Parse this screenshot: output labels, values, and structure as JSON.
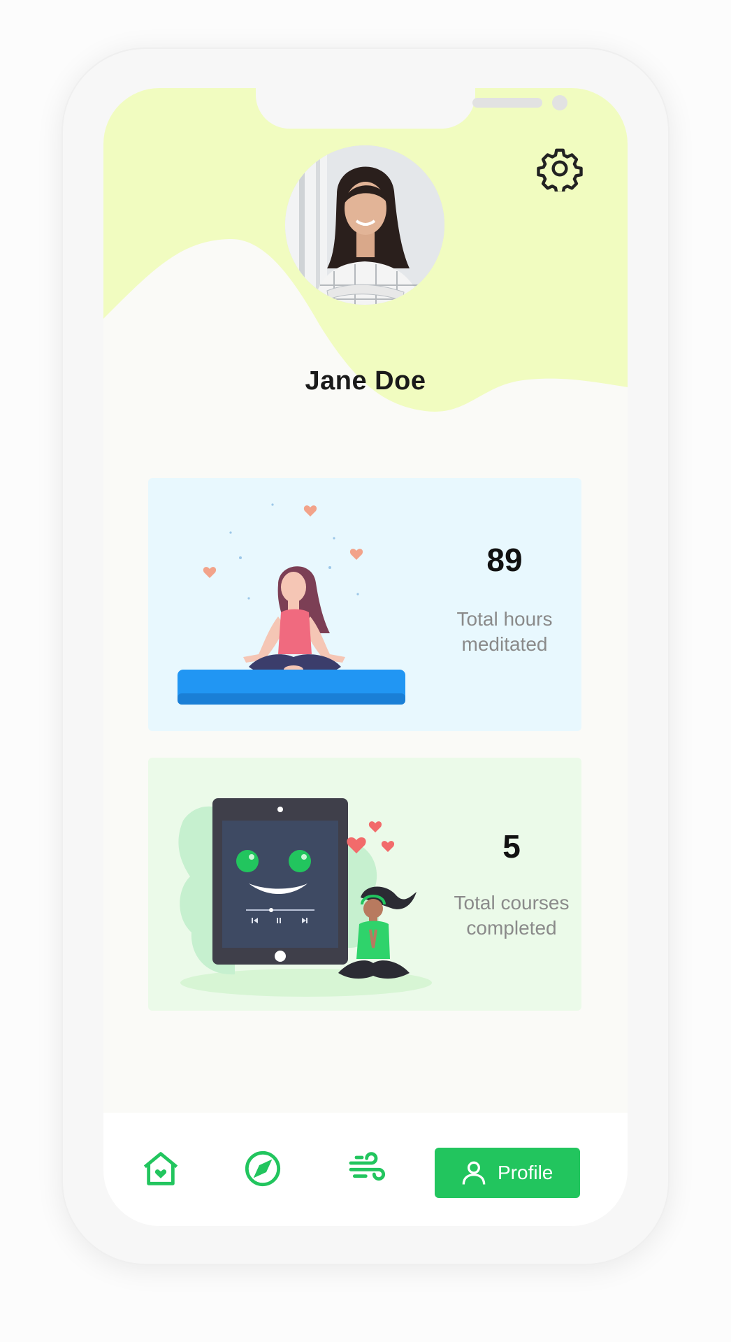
{
  "profile": {
    "name": "Jane Doe"
  },
  "stats": [
    {
      "value": "89",
      "label_line1": "Total hours",
      "label_line2": "meditated"
    },
    {
      "value": "5",
      "label_line1": "Total courses",
      "label_line2": "completed"
    }
  ],
  "nav": {
    "items": [
      {
        "icon": "home-icon"
      },
      {
        "icon": "compass-icon"
      },
      {
        "icon": "wind-icon"
      }
    ],
    "active_label": "Profile"
  },
  "colors": {
    "accent": "#22c55e",
    "header": "#f1fcc0",
    "card_blue": "#e8f8fe",
    "card_green": "#ebfae9"
  }
}
